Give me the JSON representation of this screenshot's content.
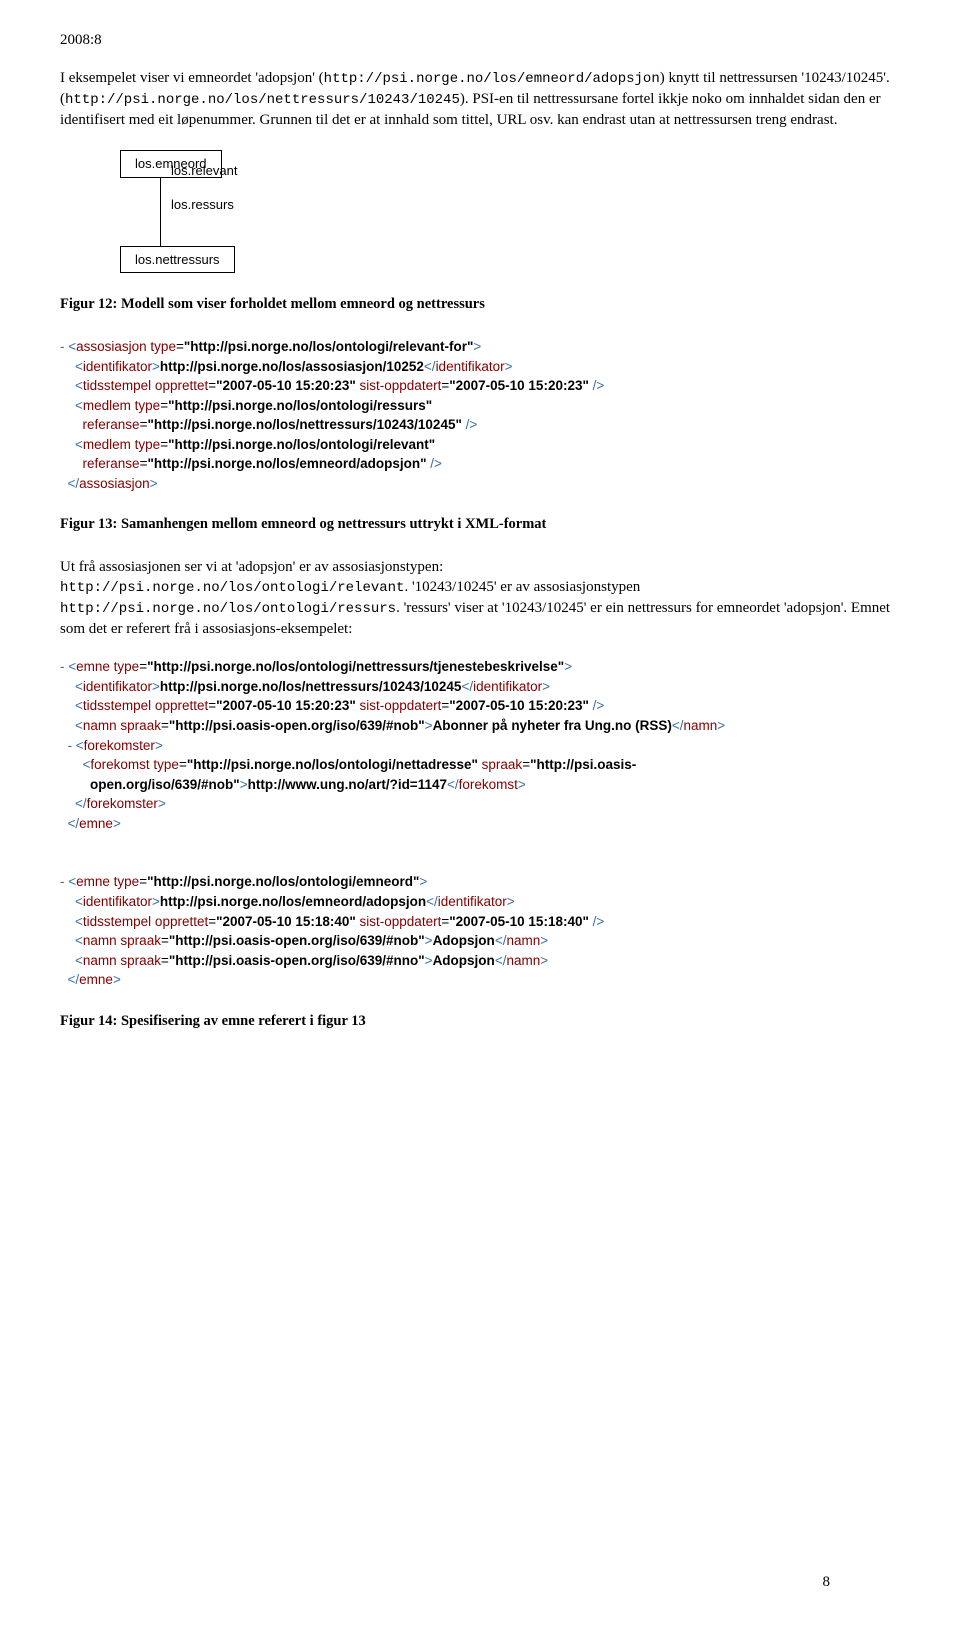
{
  "header": "2008:8",
  "para1_a": "I eksempelet viser vi emneordet 'adopsjon' (",
  "para1_url1": "http://psi.norge.no/los/emneord/adopsjon",
  "para1_b": ") knytt til nettressursen '10243/10245'. (",
  "para1_url2": "http://psi.norge.no/los/nettressurs/10243/10245",
  "para1_c": "). PSI-en til nettressursane fortel ikkje noko om innhaldet sidan den er identifisert med eit løpenummer. Grunnen til det er at innhald som tittel, URL osv. kan endrast utan at nettressursen treng endrast.",
  "diagram": {
    "top_box": "los.emneord",
    "link1": "los.relevant",
    "link2": "los.ressurs",
    "bottom_box": "los.nettressurs"
  },
  "fig12_caption": "Figur 12: Modell som viser forholdet mellom emneord og nettressurs",
  "xml1": {
    "l1a": "<assosiasjon type=",
    "l1b": "\"http://psi.norge.no/los/ontologi/relevant-for\"",
    "l1c": ">",
    "l2a": "<identifikator>",
    "l2b": "http://psi.norge.no/los/assosiasjon/10252",
    "l2c": "</identifikator>",
    "l3a": "<tidsstempel opprettet=",
    "l3b": "\"2007-05-10 15:20:23\"",
    "l3c": " sist-oppdatert=",
    "l3d": "\"2007-05-10 15:20:23\"",
    "l3e": " />",
    "l4a": "<medlem type=",
    "l4b": "\"http://psi.norge.no/los/ontologi/ressurs\"",
    "l5a": "referanse=",
    "l5b": "\"http://psi.norge.no/los/nettressurs/10243/10245\"",
    "l5c": " />",
    "l6a": "<medlem type=",
    "l6b": "\"http://psi.norge.no/los/ontologi/relevant\"",
    "l7a": "referanse=",
    "l7b": "\"http://psi.norge.no/los/emneord/adopsjon\"",
    "l7c": " />",
    "l8": "</assosiasjon>"
  },
  "fig13_caption": "Figur 13: Samanhengen mellom emneord og nettressurs uttrykt i XML-format",
  "para2_a": "Ut frå assosiasjonen ser vi at 'adopsjon' er av assosiasjonstypen:",
  "para2_url1": "http://psi.norge.no/los/ontologi/relevant",
  "para2_b": ". '10243/10245' er av assosiasjonstypen",
  "para2_url2": "http://psi.norge.no/los/ontologi/ressurs",
  "para2_c": ". 'ressurs' viser at '10243/10245' er ein nettressurs for emneordet 'adopsjon'. Emnet som det er referert frå i assosiasjons-eksempelet:",
  "xml2": {
    "l1a": "<emne type=",
    "l1b": "\"http://psi.norge.no/los/ontologi/nettressurs/tjenestebeskrivelse\"",
    "l1c": ">",
    "l2a": "<identifikator>",
    "l2b": "http://psi.norge.no/los/nettressurs/10243/10245",
    "l2c": "</identifikator>",
    "l3a": "<tidsstempel opprettet=",
    "l3b": "\"2007-05-10 15:20:23\"",
    "l3c": " sist-oppdatert=",
    "l3d": "\"2007-05-10 15:20:23\"",
    "l3e": " />",
    "l4a": "<namn spraak=",
    "l4b": "\"http://psi.oasis-open.org/iso/639/#nob\"",
    "l4c": ">",
    "l4d": "Abonner på nyheter fra Ung.no (RSS)",
    "l4e": "</namn>",
    "l5a": "<forekomster>",
    "l6a": "<forekomst type=",
    "l6b": "\"http://psi.norge.no/los/ontologi/nettadresse\"",
    "l6c": " spraak=",
    "l6d": "\"http://psi.oasis-",
    "l7a": "open.org/iso/639/#nob\"",
    "l7b": ">",
    "l7c": "http://www.ung.no/art/?id=1147",
    "l7d": "</forekomst>",
    "l8a": "</forekomster>",
    "l9a": "</emne>"
  },
  "xml3": {
    "l1a": "<emne type=",
    "l1b": "\"http://psi.norge.no/los/ontologi/emneord\"",
    "l1c": ">",
    "l2a": "<identifikator>",
    "l2b": "http://psi.norge.no/los/emneord/adopsjon",
    "l2c": "</identifikator>",
    "l3a": "<tidsstempel opprettet=",
    "l3b": "\"2007-05-10 15:18:40\"",
    "l3c": " sist-oppdatert=",
    "l3d": "\"2007-05-10 15:18:40\"",
    "l3e": " />",
    "l4a": "<namn spraak=",
    "l4b": "\"http://psi.oasis-open.org/iso/639/#nob\"",
    "l4c": ">",
    "l4d": "Adopsjon",
    "l4e": "</namn>",
    "l5a": "<namn spraak=",
    "l5b": "\"http://psi.oasis-open.org/iso/639/#nno\"",
    "l5c": ">",
    "l5d": "Adopsjon",
    "l5e": "</namn>",
    "l6a": "</emne>"
  },
  "fig14_caption": "Figur 14: Spesifisering av emne referert i figur 13",
  "page_number": "8"
}
